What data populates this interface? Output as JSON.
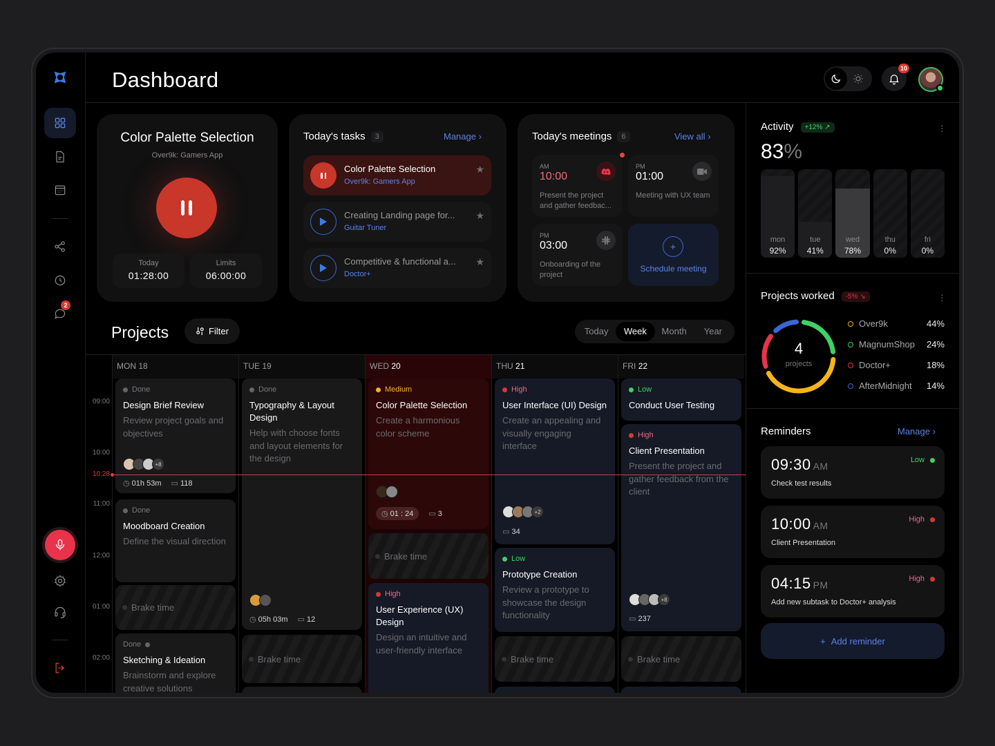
{
  "header": {
    "title": "Dashboard",
    "notification_count": "10"
  },
  "sidebar": {
    "chat_badge": "2"
  },
  "timer_card": {
    "title": "Color Palette Selection",
    "subtitle": "Over9k: Gamers App",
    "today_label": "Today",
    "today_value": "01:28:00",
    "limits_label": "Limits",
    "limits_value": "06:00:00"
  },
  "tasks": {
    "title": "Today's tasks",
    "count": "3",
    "manage": "Manage",
    "items": [
      {
        "title": "Color Palette Selection",
        "project": "Over9k: Gamers App",
        "state": "playing"
      },
      {
        "title": "Creating Landing page for...",
        "project": "Guitar Tuner",
        "state": "paused"
      },
      {
        "title": "Competitive & functional a...",
        "project": "Doctor+",
        "state": "paused"
      }
    ]
  },
  "meetings": {
    "title": "Today's meetings",
    "count": "6",
    "view_all": "View all",
    "items": [
      {
        "ampm": "AM",
        "time": "10:00",
        "desc": "Present the project and gather feedbac...",
        "app": "discord"
      },
      {
        "ampm": "PM",
        "time": "01:00",
        "desc": "Meeting with UX team",
        "app": "video"
      },
      {
        "ampm": "PM",
        "time": "03:00",
        "desc": "Onboarding of the project",
        "app": "slack"
      }
    ],
    "schedule": "Schedule meeting"
  },
  "projects": {
    "title": "Projects",
    "filter": "Filter",
    "views": [
      "Today",
      "Week",
      "Month",
      "Year"
    ],
    "active_view": "Week",
    "times": [
      "09:00",
      "10:00",
      "11:00",
      "12:00",
      "01:00",
      "02:00"
    ],
    "now": "10:28",
    "days": [
      {
        "dow": "MON",
        "num": "18"
      },
      {
        "dow": "TUE",
        "num": "19"
      },
      {
        "dow": "WED",
        "num": "20"
      },
      {
        "dow": "THU",
        "num": "21"
      },
      {
        "dow": "FRI",
        "num": "22"
      }
    ],
    "brake": "Brake time",
    "events": {
      "mon1": {
        "status": "Done",
        "title": "Design Brief Review",
        "desc": "Review project goals and objectives",
        "more": "+8",
        "duration": "01h 53m",
        "comments": "118"
      },
      "mon2": {
        "status": "Done",
        "title": "Moodboard Creation",
        "desc": "Define the visual direction"
      },
      "mon3": {
        "status": "Done",
        "title": "Sketching & Ideation",
        "desc": "Brainstorm and explore creative solutions"
      },
      "tue1": {
        "status": "Done",
        "title": "Typography & Layout Design",
        "desc": "Help with choose fonts and layout elements for the design",
        "duration": "05h 03m",
        "comments": "12"
      },
      "wed1": {
        "status": "Medium",
        "title": "Color Palette Selection",
        "desc": "Create a harmonious color scheme",
        "timer": "01 : 24",
        "comments": "3"
      },
      "wed2": {
        "status": "High",
        "title": "User Experience (UX) Design",
        "desc": "Design an intuitive and user-friendly interface"
      },
      "thu1": {
        "status": "High",
        "title": "User Interface (UI) Design",
        "desc": "Create an appealing and visually engaging interface",
        "more": "+2",
        "comments": "34"
      },
      "thu2": {
        "status": "Low",
        "title": "Prototype Creation",
        "desc": "Review a prototype to showcase the design functionality"
      },
      "fri1": {
        "status": "Low",
        "title": "Conduct User Testing"
      },
      "fri2": {
        "status": "High",
        "title": "Client Presentation",
        "desc": "Present the project and gather feedback from the client",
        "more": "+8",
        "comments": "237"
      }
    }
  },
  "activity": {
    "title": "Activity",
    "change": "+12%",
    "value": "83",
    "unit": "%",
    "days": [
      {
        "day": "mon",
        "pct": 92
      },
      {
        "day": "tue",
        "pct": 41
      },
      {
        "day": "wed",
        "pct": 78
      },
      {
        "day": "thu",
        "pct": 0
      },
      {
        "day": "fri",
        "pct": 0
      }
    ]
  },
  "projects_worked": {
    "title": "Projects worked",
    "change": "-5%",
    "count": "4",
    "count_label": "projects",
    "items": [
      {
        "name": "Over9k",
        "pct": "44%",
        "color": "#f4b41a"
      },
      {
        "name": "MagnumShop",
        "pct": "24%",
        "color": "#3fd163"
      },
      {
        "name": "Doctor+",
        "pct": "18%",
        "color": "#e8334a"
      },
      {
        "name": "AfterMidnight",
        "pct": "14%",
        "color": "#3b66d6"
      }
    ]
  },
  "reminders": {
    "title": "Reminders",
    "manage": "Manage",
    "items": [
      {
        "time": "09:30",
        "ampm": "AM",
        "text": "Check test results",
        "priority": "Low"
      },
      {
        "time": "10:00",
        "ampm": "AM",
        "text": "Client Presentation",
        "priority": "High"
      },
      {
        "time": "04:15",
        "ampm": "PM",
        "text": "Add new subtask  to Doctor+ analysis",
        "priority": "High"
      }
    ],
    "add": "Add reminder"
  },
  "colors": {
    "accent": "#3b66d6",
    "danger": "#c9362a",
    "success": "#3fd163",
    "warning": "#f4b41a"
  }
}
